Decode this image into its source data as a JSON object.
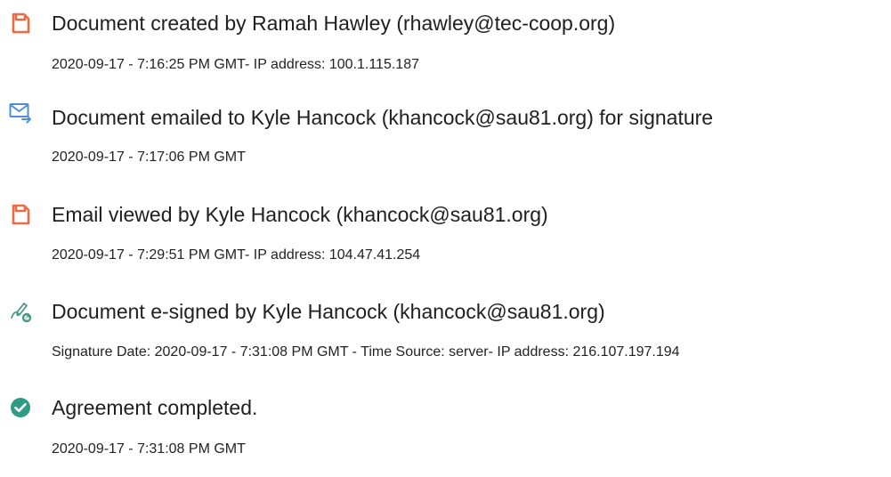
{
  "events": [
    {
      "icon": "document-created-icon",
      "title": "Document created by Ramah Hawley (rhawley@tec-coop.org)",
      "detail": "2020-09-17 - 7:16:25 PM GMT- IP address: 100.1.115.187"
    },
    {
      "icon": "email-sent-icon",
      "title": "Document emailed to Kyle Hancock (khancock@sau81.org) for signature",
      "detail": "2020-09-17 - 7:17:06 PM GMT"
    },
    {
      "icon": "document-viewed-icon",
      "title": "Email viewed by Kyle Hancock (khancock@sau81.org)",
      "detail": "2020-09-17 - 7:29:51 PM GMT- IP address: 104.47.41.254"
    },
    {
      "icon": "esign-pen-icon",
      "title": "Document e-signed by Kyle Hancock (khancock@sau81.org)",
      "detail": "Signature Date: 2020-09-17 - 7:31:08 PM GMT - Time Source: server- IP address: 216.107.197.194"
    },
    {
      "icon": "checkmark-circle-icon",
      "title": "Agreement completed.",
      "detail": "2020-09-17 - 7:31:08 PM GMT"
    }
  ],
  "colors": {
    "document_icon": "#ec6b43",
    "email_icon": "#4f8fd8",
    "pen_icon": "#4a9a85",
    "check_icon": "#2e9b84"
  }
}
